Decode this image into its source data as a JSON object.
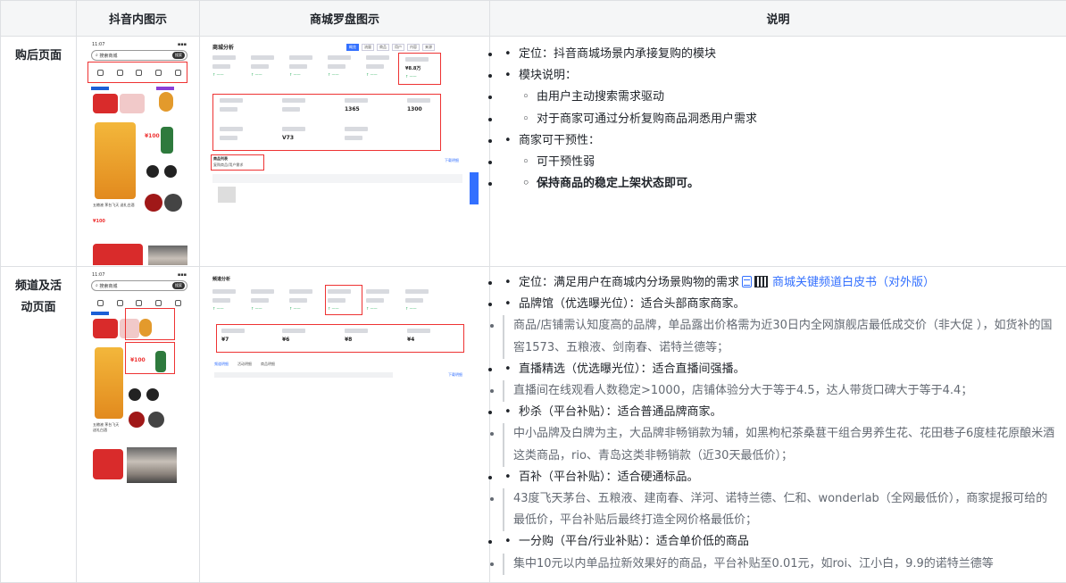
{
  "headers": [
    "",
    "抖音内图示",
    "商城罗盘图示",
    "说明"
  ],
  "row1": {
    "label": "购后页面",
    "phone": {
      "time": "11:07",
      "search_text": "搜索商城",
      "search_btn": "搜索",
      "price1": "¥100",
      "price2": "¥100",
      "caption": "五粮液 茅台飞天 送礼白酒"
    },
    "dash": {
      "title": "商城分析",
      "tabs": [
        "概览",
        "流量",
        "商品",
        "用户",
        "内容",
        "来源"
      ],
      "kpi_highlight": "¥8.8万",
      "kpi_values": [
        "1365",
        "1300",
        "V73"
      ],
      "section": "商品列表",
      "section_sub": "复购商品/用户需求",
      "download": "下载明细"
    },
    "notes": [
      {
        "level": 1,
        "text": "定位：抖音商城场景内承接复购的模块",
        "bold": false
      },
      {
        "level": 1,
        "text": "模块说明：",
        "bold": false
      },
      {
        "level": 2,
        "text": "由用户主动搜索需求驱动",
        "bold": false
      },
      {
        "level": 2,
        "text": "对于商家可通过分析复购商品洞悉用户需求",
        "bold": false
      },
      {
        "level": 1,
        "text": "商家可干预性：",
        "bold": false
      },
      {
        "level": 2,
        "text": "可干预性弱",
        "bold": false
      },
      {
        "level": 2,
        "text": "保持商品的稳定上架状态即可。",
        "bold": true
      }
    ]
  },
  "row2": {
    "label": "频道及活动页面",
    "phone": {
      "time": "11:07",
      "search_text": "搜索商城",
      "search_btn": "搜索",
      "price1": "¥100",
      "caption": "五粮液 茅台飞天 送礼白酒"
    },
    "dash": {
      "title": "频道分析",
      "tabs": [
        "频道",
        "活动"
      ],
      "kpi_values": [
        "¥7",
        "¥6",
        "¥8",
        "¥4"
      ],
      "links": [
        "频道明细",
        "活动明细",
        "商品明细"
      ],
      "download": "下载明细"
    },
    "positioning_prefix": "定位：满足用户在商城内分场景购物的需求",
    "positioning_link": "商城关键频道白皮书（对外版）",
    "items": [
      {
        "title": "品牌馆（优选曝光位）：适合头部商家商家。",
        "desc": "商品/店铺需认知度高的品牌，单品露出价格需为近30日内全网旗舰店最低成交价（非大促 ），如货补的国窖1573、五粮液、剑南春、诺特兰德等；"
      },
      {
        "title": "直播精选（优选曝光位）：适合直播间强播。",
        "desc": "直播间在线观看人数稳定>1000，店铺体验分大于等于4.5，达人带货口碑大于等于4.4；"
      },
      {
        "title": "秒杀（平台补贴）：适合普通品牌商家。",
        "desc": "中小品牌及白牌为主，大品牌非畅销款为辅，如黑枸杞茶桑葚干组合男养生花、花田巷子6度桂花原酿米酒这类商品，rio、青岛这类非畅销款（近30天最低价）；"
      },
      {
        "title": "百补（平台补贴）：适合硬通标品。",
        "desc": "43度飞天茅台、五粮液、建南春、洋河、诺特兰德、仁和、wonderlab（全网最低价），商家提报可给的最低价，平台补贴后最终打造全网价格最低价；"
      },
      {
        "title": "一分购（平台/行业补贴）：适合单价低的商品",
        "desc": "集中10元以内单品拉新效果好的商品，平台补贴至0.01元，如roi、江小白，9.9的诺特兰德等"
      }
    ]
  }
}
